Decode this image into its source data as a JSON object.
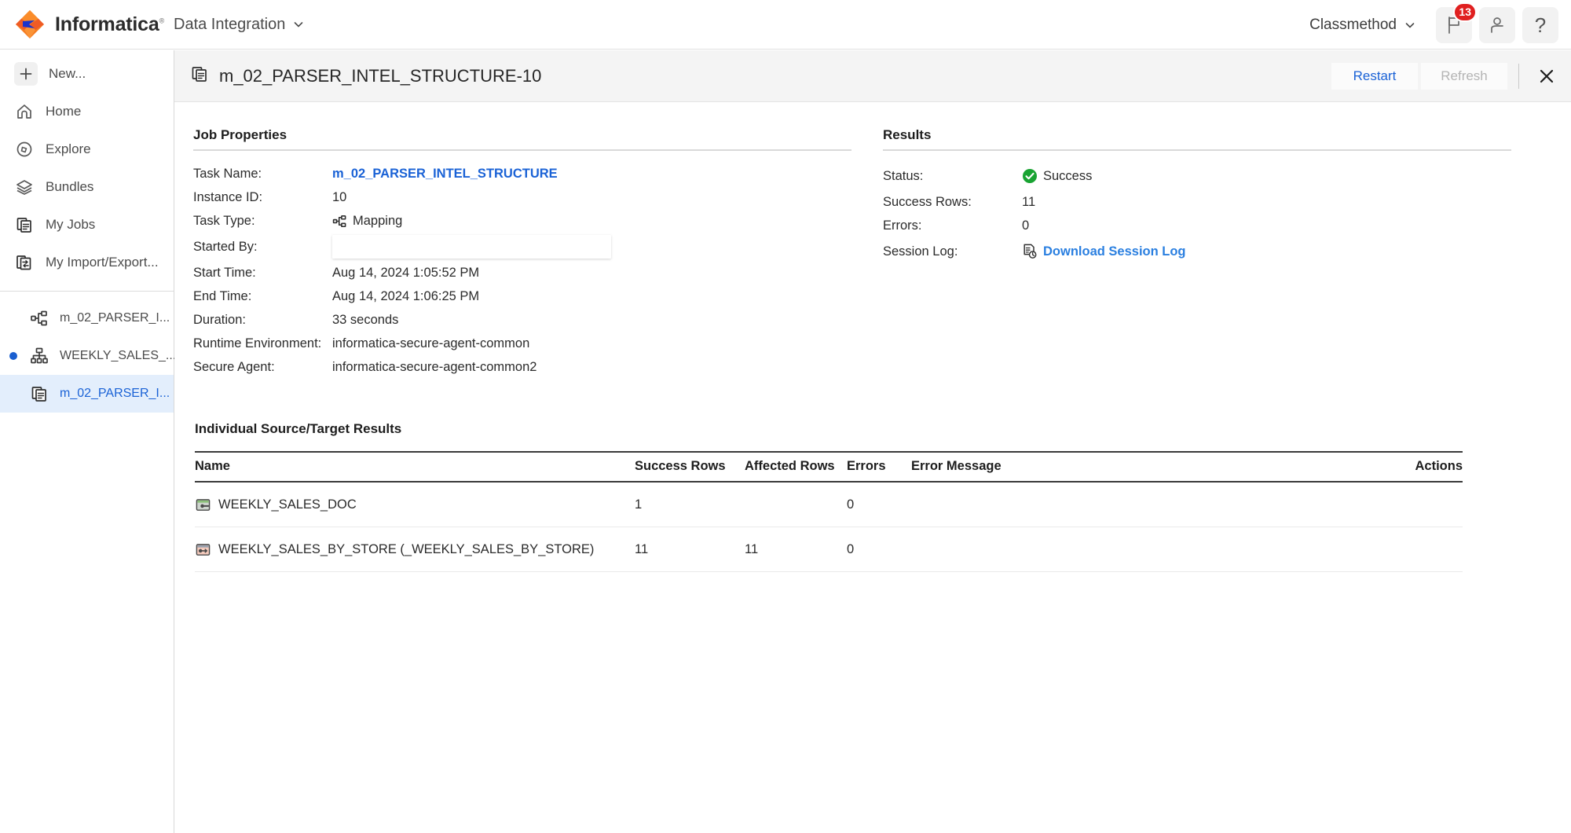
{
  "topbar": {
    "brand": "Informatica",
    "brand_sup": "®",
    "product": "Data Integration",
    "org": "Classmethod",
    "notification_badge": "13",
    "help_glyph": "?",
    "icons": {
      "flag": "flag-icon",
      "user": "user-icon",
      "help": "help-icon",
      "chevron": "chevron-down-icon"
    }
  },
  "sidebar": {
    "items": [
      {
        "label": "New...",
        "icon": "plus-icon"
      },
      {
        "label": "Home",
        "icon": "home-icon"
      },
      {
        "label": "Explore",
        "icon": "compass-icon"
      },
      {
        "label": "Bundles",
        "icon": "layers-icon"
      },
      {
        "label": "My Jobs",
        "icon": "documents-icon"
      },
      {
        "label": "My Import/Export...",
        "icon": "import-export-icon"
      }
    ],
    "jobs": [
      {
        "label": "m_02_PARSER_I...",
        "icon": "mapping-icon",
        "dot": false,
        "selected": false
      },
      {
        "label": "WEEKLY_SALES_...",
        "icon": "hierarchy-icon",
        "dot": true,
        "selected": false
      },
      {
        "label": "m_02_PARSER_I...",
        "icon": "documents-icon",
        "dot": false,
        "selected": true
      }
    ]
  },
  "panel": {
    "title": "m_02_PARSER_INTEL_STRUCTURE-10",
    "title_icon": "documents-icon",
    "restart_label": "Restart",
    "refresh_label": "Refresh",
    "close_icon": "close-icon"
  },
  "job_properties": {
    "heading": "Job Properties",
    "rows": [
      {
        "label": "Task Name:",
        "value": "m_02_PARSER_INTEL_STRUCTURE",
        "type": "link"
      },
      {
        "label": "Instance ID:",
        "value": "10",
        "type": "text"
      },
      {
        "label": "Task Type:",
        "value": "Mapping",
        "type": "icon-text",
        "icon": "mapping-icon"
      },
      {
        "label": "Started By:",
        "value": "",
        "type": "redacted"
      },
      {
        "label": "Start Time:",
        "value": "Aug 14, 2024 1:05:52 PM",
        "type": "text"
      },
      {
        "label": "End Time:",
        "value": "Aug 14, 2024 1:06:25 PM",
        "type": "text"
      },
      {
        "label": "Duration:",
        "value": "33 seconds",
        "type": "text"
      },
      {
        "label": "Runtime Environment:",
        "value": "informatica-secure-agent-common",
        "type": "text"
      },
      {
        "label": "Secure Agent:",
        "value": "informatica-secure-agent-common2",
        "type": "text"
      }
    ]
  },
  "results": {
    "heading": "Results",
    "status_label": "Status:",
    "status_value": "Success",
    "status_color": "#1aa332",
    "success_rows_label": "Success Rows:",
    "success_rows_value": "11",
    "errors_label": "Errors:",
    "errors_value": "0",
    "session_log_label": "Session Log:",
    "session_log_link": "Download Session Log",
    "session_log_icon": "log-download-icon"
  },
  "source_target": {
    "heading": "Individual Source/Target Results",
    "columns": [
      "Name",
      "Success Rows",
      "Affected Rows",
      "Errors",
      "Error Message",
      "Actions"
    ],
    "rows": [
      {
        "name": "WEEKLY_SALES_DOC",
        "icon": "source-object-icon",
        "success_rows": "1",
        "affected_rows": "",
        "errors": "0",
        "error_message": "",
        "actions": ""
      },
      {
        "name": "WEEKLY_SALES_BY_STORE (_WEEKLY_SALES_BY_STORE)",
        "icon": "target-object-icon",
        "success_rows": "11",
        "affected_rows": "11",
        "errors": "0",
        "error_message": "",
        "actions": ""
      }
    ]
  },
  "colors": {
    "link_blue": "#1a62d6",
    "success_green": "#1aa332",
    "badge_red": "#e02020",
    "brand_orange": "#f26b21",
    "selected_row_bg": "#e3eefc"
  }
}
